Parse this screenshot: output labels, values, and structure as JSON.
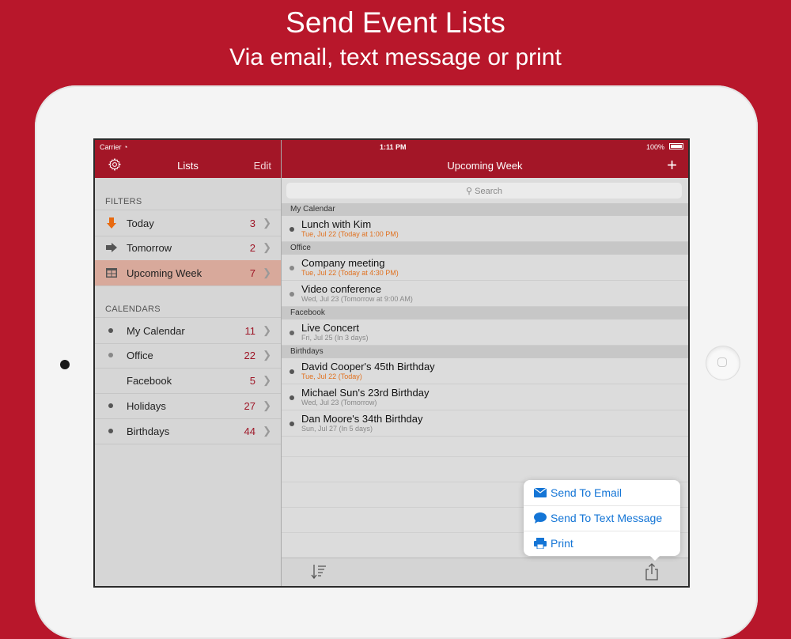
{
  "promo": {
    "title": "Send Event Lists",
    "subtitle": "Via email, text message or print"
  },
  "status": {
    "carrier": "Carrier",
    "time": "1:11 PM",
    "battery": "100%"
  },
  "sidebar": {
    "title": "Lists",
    "edit_label": "Edit",
    "filters_header": "FILTERS",
    "filters": [
      {
        "label": "Today",
        "count": "3",
        "icon": "down-arrow-icon"
      },
      {
        "label": "Tomorrow",
        "count": "2",
        "icon": "right-arrow-icon"
      },
      {
        "label": "Upcoming Week",
        "count": "7",
        "icon": "week-grid-icon"
      }
    ],
    "calendars_header": "CALENDARS",
    "calendars": [
      {
        "label": "My Calendar",
        "count": "11"
      },
      {
        "label": "Office",
        "count": "22"
      },
      {
        "label": "Facebook",
        "count": "5"
      },
      {
        "label": "Holidays",
        "count": "27"
      },
      {
        "label": "Birthdays",
        "count": "44"
      }
    ]
  },
  "main": {
    "title": "Upcoming Week",
    "search_placeholder": "Search",
    "groups": [
      {
        "name": "My Calendar",
        "events": [
          {
            "title": "Lunch with Kim",
            "when": "Tue, Jul 22 (Today at 1:00 PM)",
            "today": true
          }
        ]
      },
      {
        "name": "Office",
        "events": [
          {
            "title": "Company meeting",
            "when": "Tue, Jul 22 (Today at 4:30 PM)",
            "today": true
          },
          {
            "title": "Video conference",
            "when": "Wed, Jul 23 (Tomorrow at 9:00 AM)",
            "today": false
          }
        ]
      },
      {
        "name": "Facebook",
        "events": [
          {
            "title": "Live Concert",
            "when": "Fri, Jul 25 (In 3 days)",
            "today": false
          }
        ]
      },
      {
        "name": "Birthdays",
        "events": [
          {
            "title": "David Cooper's 45th Birthday",
            "when": "Tue, Jul 22 (Today)",
            "today": true
          },
          {
            "title": "Michael Sun's 23rd Birthday",
            "when": "Wed, Jul 23 (Tomorrow)",
            "today": false
          },
          {
            "title": "Dan Moore's 34th Birthday",
            "when": "Sun, Jul 27 (In 5 days)",
            "today": false
          }
        ]
      }
    ]
  },
  "share_menu": {
    "email": "Send To Email",
    "text": "Send To Text Message",
    "print": "Print"
  },
  "colors": {
    "brand_red": "#b8172b",
    "nav_red": "#a31627",
    "today_orange": "#e0701e",
    "link_blue": "#1475d6"
  }
}
